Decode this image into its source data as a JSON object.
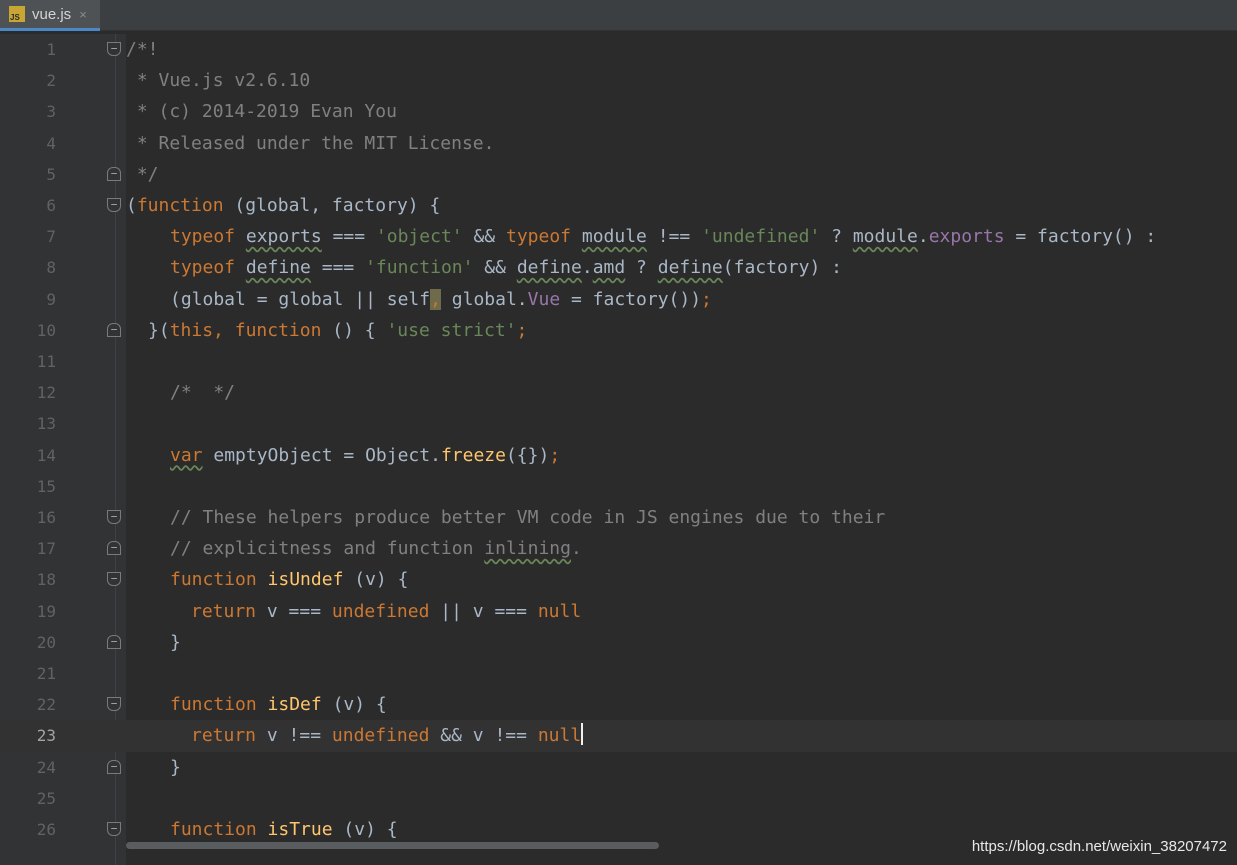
{
  "tab": {
    "filename": "vue.js",
    "icon": "js-file-icon",
    "close": "×"
  },
  "editor": {
    "current_line": 23,
    "lines": [
      "1",
      "2",
      "3",
      "4",
      "5",
      "6",
      "7",
      "8",
      "9",
      "10",
      "11",
      "12",
      "13",
      "14",
      "15",
      "16",
      "17",
      "18",
      "19",
      "20",
      "21",
      "22",
      "23",
      "24",
      "25",
      "26"
    ],
    "code": {
      "l1": "/*!",
      "l2": " * Vue.js v2.6.10",
      "l3": " * (c) 2014-2019 Evan You",
      "l4": " * Released under the MIT License.",
      "l5": " */",
      "l6a": "(",
      "l6b": "function",
      "l6c": " (global, factory) {",
      "l7a": "typeof",
      "l7b": " ",
      "l7c": "exports",
      "l7d": " === ",
      "l7e": "'object'",
      "l7f": " && ",
      "l7g": "typeof",
      "l7h": " ",
      "l7i": "module",
      "l7j": " !== ",
      "l7k": "'undefined'",
      "l7l": " ? ",
      "l7m": "module",
      "l7n": ".",
      "l7o": "exports",
      "l7p": " = factory() :",
      "l8a": "typeof",
      "l8b": " ",
      "l8c": "define",
      "l8d": " === ",
      "l8e": "'function'",
      "l8f": " && ",
      "l8g": "define",
      "l8h": ".",
      "l8i": "amd",
      "l8j": " ? ",
      "l8k": "define",
      "l8l": "(factory) :",
      "l9a": "(global = global || self",
      "l9b": ",",
      "l9c": " global.",
      "l9d": "Vue",
      "l9e": " = factory())",
      "l9f": ";",
      "l10a": "}(",
      "l10b": "this",
      "l10c": ", ",
      "l10d": "function",
      "l10e": " () { ",
      "l10f": "'use strict'",
      "l10g": ";",
      "l12": "/*  */",
      "l14a": "var",
      "l14b": " emptyObject = Object.",
      "l14c": "freeze",
      "l14d": "({})",
      "l14e": ";",
      "l16": "// These helpers produce better VM code in JS engines due to their",
      "l17a": "// explicitness and function ",
      "l17b": "inlining",
      "l17c": ".",
      "l18a": "function",
      "l18b": " ",
      "l18c": "isUndef",
      "l18d": " (v) {",
      "l19a": "return",
      "l19b": " v === ",
      "l19c": "undefined",
      "l19d": " || v === ",
      "l19e": "null",
      "l20": "}",
      "l22a": "function",
      "l22b": " ",
      "l22c": "isDef",
      "l22d": " (v) {",
      "l23a": "return",
      "l23b": " v !== ",
      "l23c": "undefined",
      "l23d": " && v !== ",
      "l23e": "null",
      "l24": "}",
      "l26a": "function",
      "l26b": " ",
      "l26c": "isTrue",
      "l26d": " (v) {"
    }
  },
  "watermark": "https://blog.csdn.net/weixin_38207472",
  "colors": {
    "background": "#2b2b2b",
    "gutter": "#313335",
    "keyword": "#cc7832",
    "string": "#6a8759",
    "comment": "#808080",
    "function_name": "#ffc66d",
    "property": "#9876aa",
    "text": "#a9b7c6",
    "tab_accent": "#4a88c7"
  }
}
